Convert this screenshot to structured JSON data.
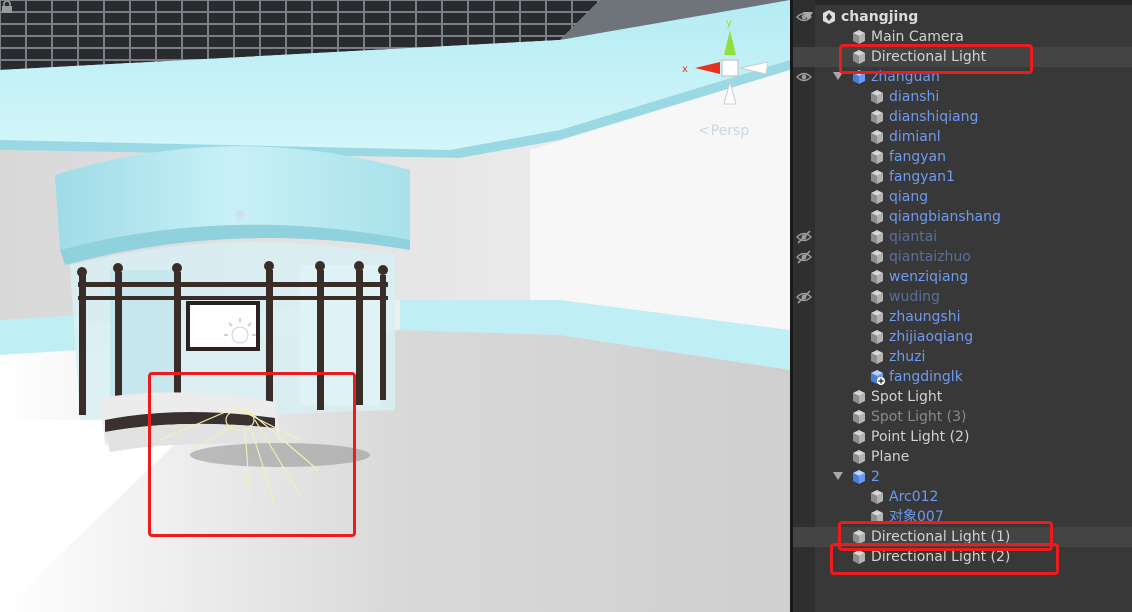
{
  "scene_view": {
    "camera_mode": "Persp",
    "gizmo_axes": [
      "y",
      "x",
      "z"
    ]
  },
  "hierarchy": {
    "rows": [
      {
        "label": "changjing",
        "style": "root",
        "depth": 0,
        "icon": "unity-scene-icon",
        "expanded": true,
        "eye": "visible"
      },
      {
        "label": "Main Camera",
        "style": "normal",
        "depth": 1,
        "icon": "gameobject-cube-icon"
      },
      {
        "label": "Directional Light",
        "style": "normal",
        "depth": 1,
        "icon": "gameobject-cube-icon",
        "selected": true
      },
      {
        "label": "zhanguan",
        "style": "blue",
        "depth": 1,
        "icon": "prefab-cube-icon",
        "expanded": true,
        "eye": "visible"
      },
      {
        "label": "dianshi",
        "style": "blue",
        "depth": 2,
        "icon": "gameobject-cube-icon"
      },
      {
        "label": "dianshiqiang",
        "style": "blue",
        "depth": 2,
        "icon": "gameobject-cube-icon"
      },
      {
        "label": "dimianl",
        "style": "blue",
        "depth": 2,
        "icon": "gameobject-cube-icon"
      },
      {
        "label": "fangyan",
        "style": "blue",
        "depth": 2,
        "icon": "gameobject-cube-icon"
      },
      {
        "label": "fangyan1",
        "style": "blue",
        "depth": 2,
        "icon": "gameobject-cube-icon"
      },
      {
        "label": "qiang",
        "style": "blue",
        "depth": 2,
        "icon": "gameobject-cube-icon"
      },
      {
        "label": "qiangbianshang",
        "style": "blue",
        "depth": 2,
        "icon": "gameobject-cube-icon"
      },
      {
        "label": "qiantai",
        "style": "dimblue",
        "depth": 2,
        "icon": "gameobject-cube-icon",
        "eye": "hidden"
      },
      {
        "label": "qiantaizhuo",
        "style": "dimblue",
        "depth": 2,
        "icon": "gameobject-cube-icon",
        "eye": "hidden"
      },
      {
        "label": "wenziqiang",
        "style": "blue",
        "depth": 2,
        "icon": "gameobject-cube-icon"
      },
      {
        "label": "wuding",
        "style": "dimblue",
        "depth": 2,
        "icon": "gameobject-cube-icon",
        "eye": "hidden"
      },
      {
        "label": "zhaungshi",
        "style": "blue",
        "depth": 2,
        "icon": "gameobject-cube-icon"
      },
      {
        "label": "zhijiaoqiang",
        "style": "blue",
        "depth": 2,
        "icon": "gameobject-cube-icon"
      },
      {
        "label": "zhuzi",
        "style": "blue",
        "depth": 2,
        "icon": "gameobject-cube-icon"
      },
      {
        "label": "fangdinglk",
        "style": "blue",
        "depth": 2,
        "icon": "prefab-added-icon"
      },
      {
        "label": "Spot Light",
        "style": "normal",
        "depth": 1,
        "icon": "gameobject-cube-icon"
      },
      {
        "label": "Spot Light (3)",
        "style": "dim",
        "depth": 1,
        "icon": "gameobject-cube-icon"
      },
      {
        "label": "Point Light (2)",
        "style": "normal",
        "depth": 1,
        "icon": "gameobject-cube-icon"
      },
      {
        "label": "Plane",
        "style": "normal",
        "depth": 1,
        "icon": "gameobject-cube-icon"
      },
      {
        "label": "2",
        "style": "blue",
        "depth": 1,
        "icon": "prefab-cube-icon",
        "expanded": true
      },
      {
        "label": "Arc012",
        "style": "blue",
        "depth": 2,
        "icon": "gameobject-cube-icon"
      },
      {
        "label": "对象007",
        "style": "blue",
        "depth": 2,
        "icon": "gameobject-cube-icon"
      },
      {
        "label": "Directional Light (1)",
        "style": "normal",
        "depth": 1,
        "icon": "gameobject-cube-icon",
        "selected": true
      },
      {
        "label": "Directional Light (2)",
        "style": "normal",
        "depth": 1,
        "icon": "gameobject-cube-icon"
      }
    ]
  },
  "annotations": {
    "highlight_color": "#ec1c1c"
  },
  "colors": {
    "hierarchy_bg": "#383838",
    "selected_row": "#444444",
    "prefab_text": "#6e9af0",
    "normal_text": "#d2d2d2"
  }
}
